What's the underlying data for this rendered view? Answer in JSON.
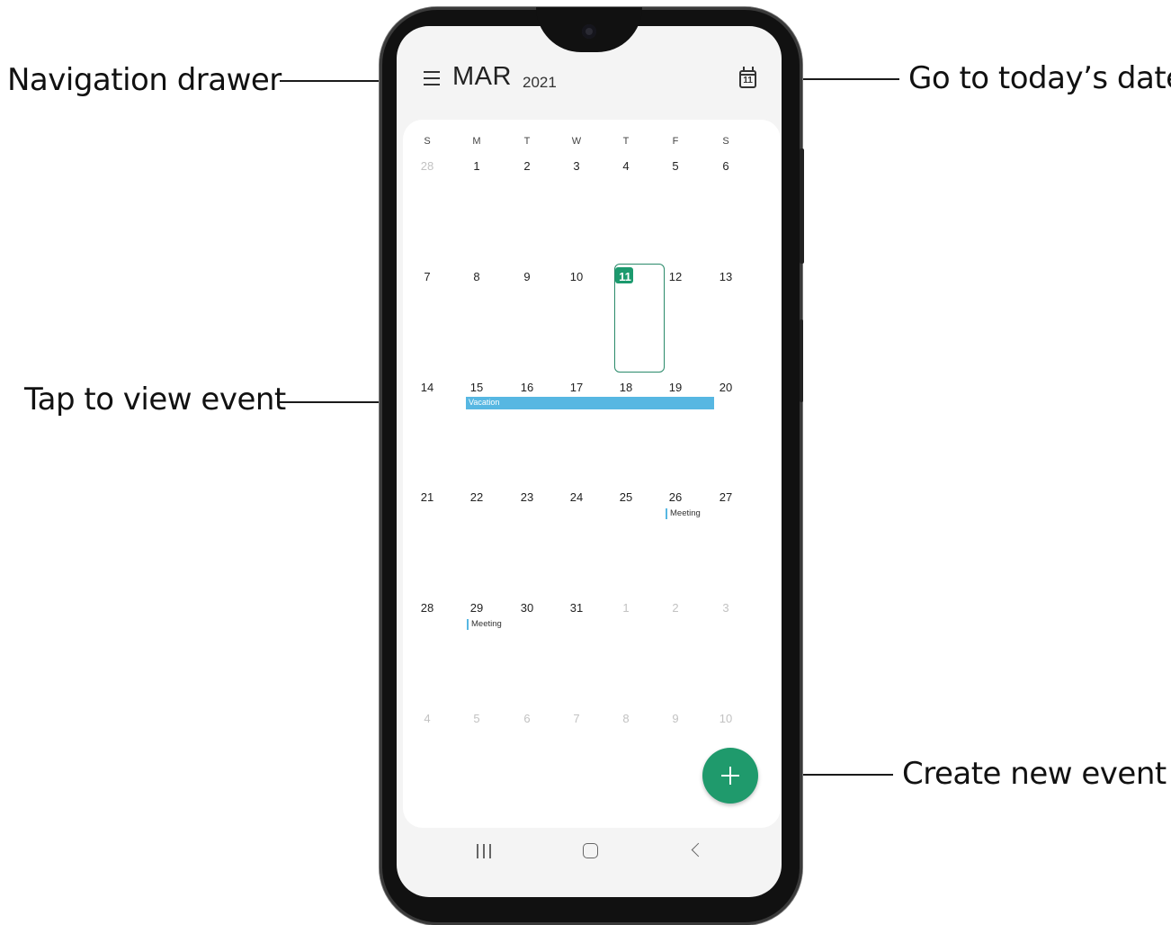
{
  "callouts": {
    "nav_drawer": "Navigation drawer",
    "today": "Go to today’s date",
    "view_event": "Tap to view event",
    "create_event": "Create new event"
  },
  "header": {
    "month": "MAR",
    "year": "2021",
    "today_icon_day": "11"
  },
  "calendar": {
    "weekdays": [
      "S",
      "M",
      "T",
      "W",
      "T",
      "F",
      "S"
    ],
    "weeks": [
      [
        "28",
        "1",
        "2",
        "3",
        "4",
        "5",
        "6"
      ],
      [
        "7",
        "8",
        "9",
        "10",
        "11",
        "12",
        "13"
      ],
      [
        "14",
        "15",
        "16",
        "17",
        "18",
        "19",
        "20"
      ],
      [
        "21",
        "22",
        "23",
        "24",
        "25",
        "26",
        "27"
      ],
      [
        "28",
        "29",
        "30",
        "31",
        "1",
        "2",
        "3"
      ],
      [
        "4",
        "5",
        "6",
        "7",
        "8",
        "9",
        "10"
      ]
    ],
    "today": "11",
    "events": {
      "vacation": "Vacation",
      "meeting_26": "Meeting",
      "meeting_29": "Meeting"
    }
  },
  "colors": {
    "accent_green": "#1f9a6c",
    "event_blue": "#57b7e2"
  },
  "icons": {
    "menu": "hamburger-menu-icon",
    "today": "calendar-today-icon",
    "fab": "plus-icon",
    "recents": "recents-icon",
    "home": "home-icon",
    "back": "back-icon"
  }
}
